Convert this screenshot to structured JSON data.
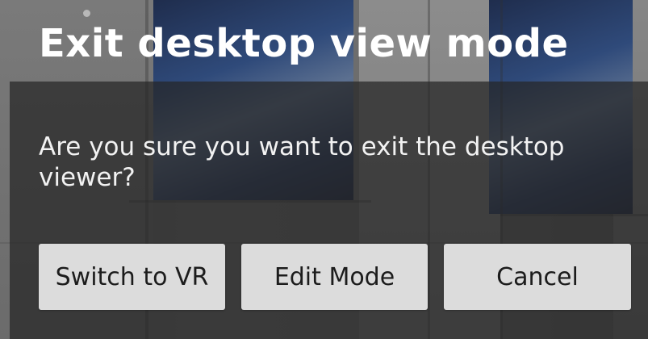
{
  "dialog": {
    "title": "Exit desktop view mode",
    "message": "Are you sure you want to exit the desktop viewer?",
    "buttons": {
      "switch_to_vr": "Switch to VR",
      "edit_mode": "Edit Mode",
      "cancel": "Cancel"
    }
  }
}
